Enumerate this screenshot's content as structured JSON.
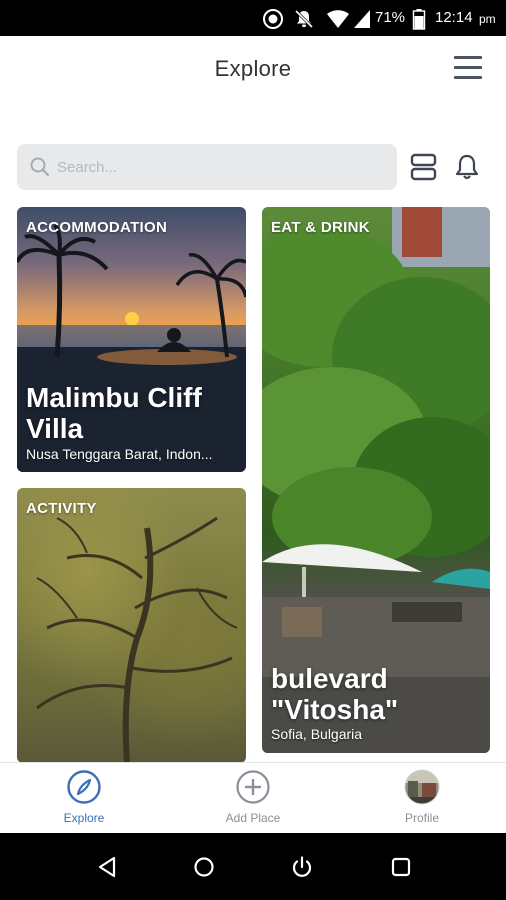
{
  "status_bar": {
    "battery": "71%",
    "time": "12:14",
    "ampm": "pm",
    "icons": [
      "target-icon",
      "notifications-off-icon",
      "wifi-icon",
      "signal-icon",
      "battery-icon"
    ]
  },
  "header": {
    "title": "Explore",
    "menu_icon": "hamburger-menu-icon"
  },
  "search": {
    "placeholder": "Search...",
    "value": ""
  },
  "toolbar": {
    "layout_icon": "layout-toggle-icon",
    "bell_icon": "bell-icon"
  },
  "cards": [
    {
      "tag": "ACCOMMODATION",
      "title_line1": "Malimbu Cliff",
      "title_line2": "Villa",
      "subtitle": "Nusa Tenggara Barat, Indon..."
    },
    {
      "tag": "EAT & DRINK",
      "title_line1": "bulevard",
      "title_line2": "\"Vitosha\"",
      "subtitle": "Sofia, Bulgaria"
    },
    {
      "tag": "ACTIVITY"
    }
  ],
  "tabs": [
    {
      "label": "Explore",
      "icon": "compass-icon",
      "active": true
    },
    {
      "label": "Add Place",
      "icon": "plus-circle-icon",
      "active": false
    },
    {
      "label": "Profile",
      "icon": "avatar",
      "active": false
    }
  ],
  "colors": {
    "accent": "#3c6fb8",
    "inactive": "#8a9097",
    "search_bg": "#e8e9ea"
  }
}
